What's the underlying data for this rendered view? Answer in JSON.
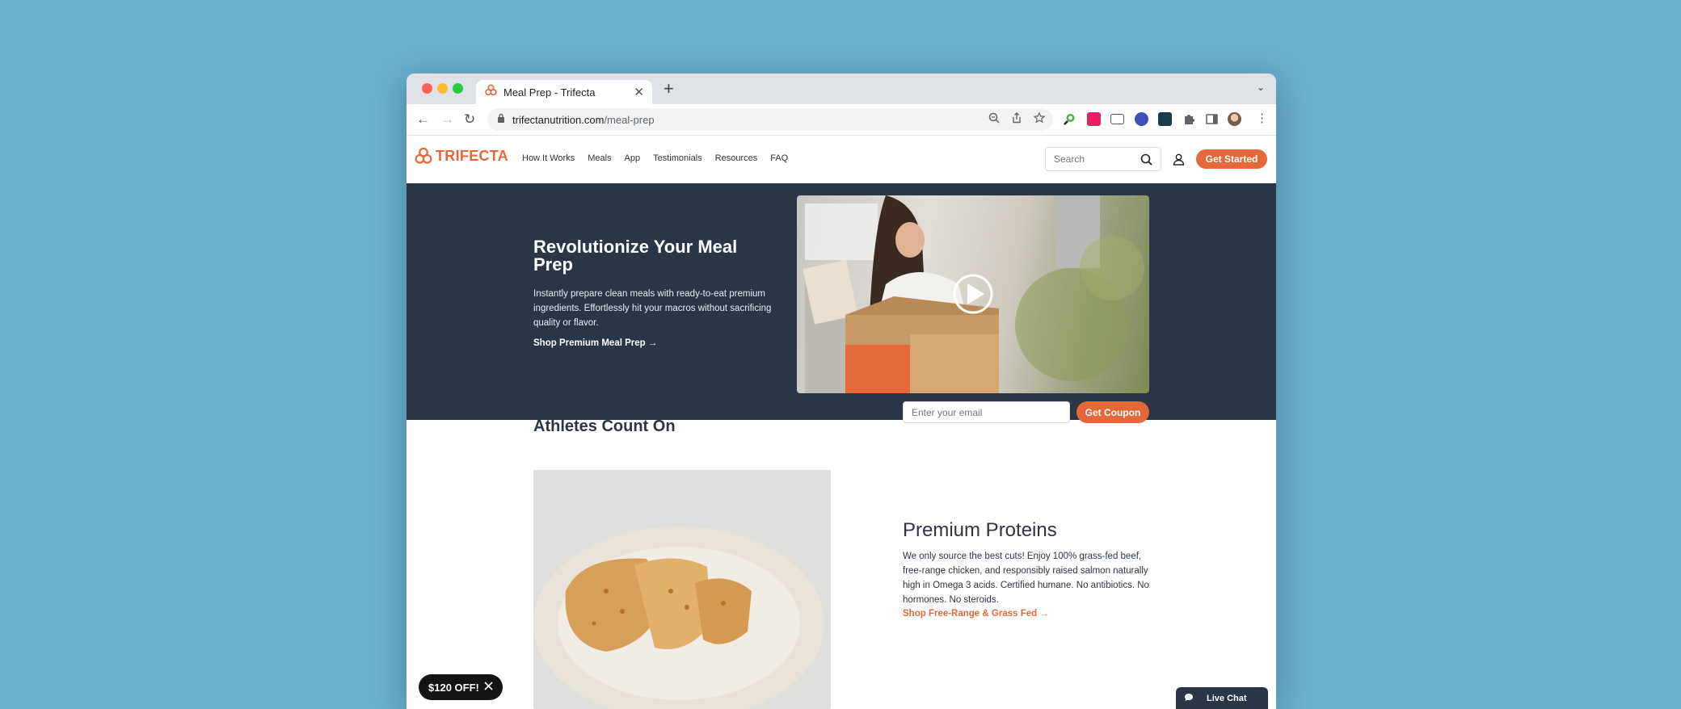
{
  "browser": {
    "tab_title": "Meal Prep - Trifecta",
    "url_domain": "trifectanutrition.com",
    "url_path": "/meal-prep"
  },
  "site": {
    "logo_text": "TRIFECTA",
    "nav": [
      "How It Works",
      "Meals",
      "App",
      "Testimonials",
      "Resources",
      "FAQ"
    ],
    "search_placeholder": "Search",
    "cta_label": "Get Started",
    "accent_color": "#e5683a",
    "dark_color": "#2a3646"
  },
  "hero": {
    "title": "Revolutionize Your Meal Prep",
    "description": "Instantly prepare clean meals with ready-to-eat premium ingredients. Effortlessly hit your macros without sacrificing quality or flavor.",
    "link_label": "Shop Premium Meal Prep"
  },
  "promo": {
    "title": "Save on the Meal System Top Athletes Count On",
    "email_placeholder": "Enter your email",
    "button_label": "Get Coupon"
  },
  "proteins": {
    "title": "Premium Proteins",
    "description": "We only source the best cuts! Enjoy 100% grass-fed beef, free-range chicken, and responsibly raised salmon naturally high in Omega 3 acids. Certified humane. No antibiotics. No hormones. No steroids.",
    "link_label": "Shop Free-Range & Grass Fed"
  },
  "discount_badge": "$120 OFF!",
  "live_chat": "Live Chat"
}
